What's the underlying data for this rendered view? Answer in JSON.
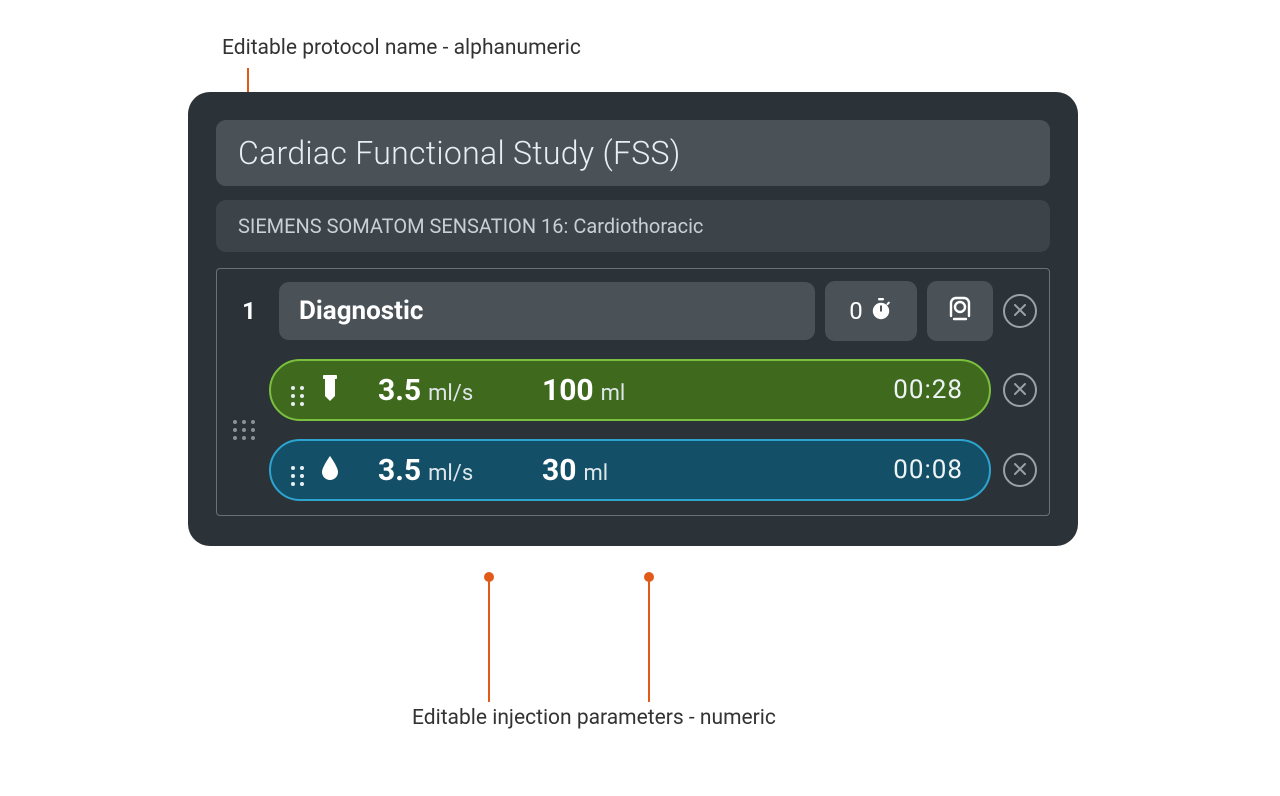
{
  "annotations": {
    "top": "Editable protocol name - alphanumeric",
    "bottom": "Editable injection parameters - numeric"
  },
  "protocol": {
    "name": "Cardiac Functional Study (FSS)",
    "scanner": "SIEMENS SOMATOM SENSATION 16: Cardiothoracic"
  },
  "phase": {
    "number": "1",
    "name": "Diagnostic",
    "delay": "0"
  },
  "rows": [
    {
      "type": "contrast",
      "rate": "3.5",
      "rate_unit": "ml/s",
      "volume": "100",
      "volume_unit": "ml",
      "time": "00:28"
    },
    {
      "type": "saline",
      "rate": "3.5",
      "rate_unit": "ml/s",
      "volume": "30",
      "volume_unit": "ml",
      "time": "00:08"
    }
  ]
}
